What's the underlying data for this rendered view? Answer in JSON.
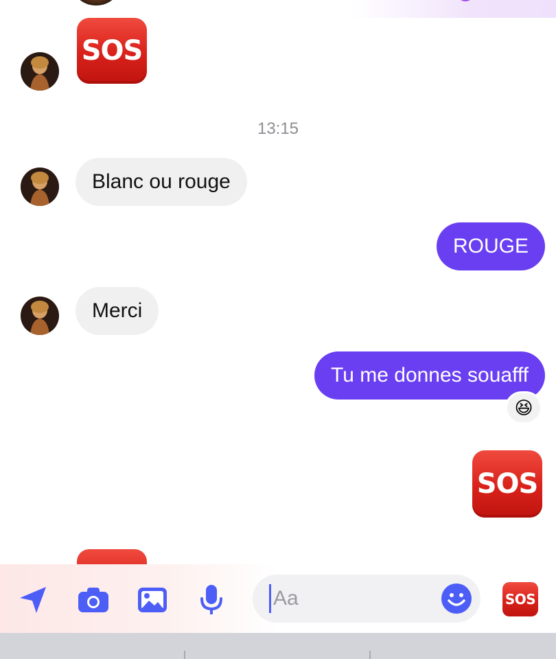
{
  "conversation": {
    "timestamp": "13:15",
    "messages": [
      {
        "direction": "in",
        "type": "emoji",
        "text": "SOS"
      },
      {
        "direction": "in",
        "type": "text",
        "text": "Blanc ou rouge"
      },
      {
        "direction": "out",
        "type": "text",
        "text": "ROUGE"
      },
      {
        "direction": "in",
        "type": "text",
        "text": "Merci"
      },
      {
        "direction": "out",
        "type": "text",
        "text": "Tu me donnes souafff",
        "reaction": "😆"
      },
      {
        "direction": "out",
        "type": "emoji",
        "text": "SOS"
      },
      {
        "direction": "in",
        "type": "emoji",
        "text": "SOS"
      }
    ]
  },
  "composer": {
    "placeholder": "Aa",
    "icons": [
      "location-arrow-icon",
      "camera-icon",
      "image-icon",
      "microphone-icon",
      "emoji-icon"
    ],
    "quick_reaction": "SOS"
  },
  "colors": {
    "accent": "#6a3ff2",
    "icon_blue": "#4c5ef6",
    "incoming_bubble": "#f0f0f0",
    "sos_red": "#d8211a"
  }
}
